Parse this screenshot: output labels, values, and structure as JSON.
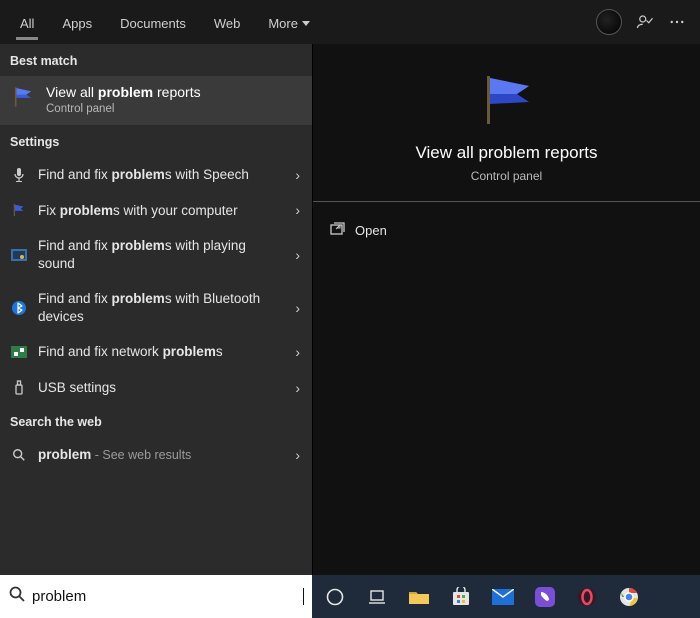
{
  "tabs": {
    "all": "All",
    "apps": "Apps",
    "documents": "Documents",
    "web": "Web",
    "more": "More"
  },
  "sections": {
    "best_match": "Best match",
    "settings": "Settings",
    "search_web": "Search the web"
  },
  "best_match": {
    "title_pre": "View all ",
    "title_bold": "problem",
    "title_post": " reports",
    "subtitle": "Control panel"
  },
  "settings_items": [
    {
      "pre": "Find and fix ",
      "bold": "problem",
      "post": "s with Speech"
    },
    {
      "pre": "Fix ",
      "bold": "problem",
      "post": "s with your computer"
    },
    {
      "pre": "Find and fix ",
      "bold": "problem",
      "post": "s with playing sound"
    },
    {
      "pre": "Find and fix ",
      "bold": "problem",
      "post": "s with Bluetooth devices"
    },
    {
      "pre": "Find and fix network ",
      "bold": "problem",
      "post": "s"
    },
    {
      "pre": "USB settings",
      "bold": "",
      "post": ""
    }
  ],
  "web_item": {
    "bold": "problem",
    "suffix": " - See web results"
  },
  "preview": {
    "title": "View all problem reports",
    "subtitle": "Control panel",
    "open": "Open"
  },
  "search": {
    "value": "problem"
  }
}
